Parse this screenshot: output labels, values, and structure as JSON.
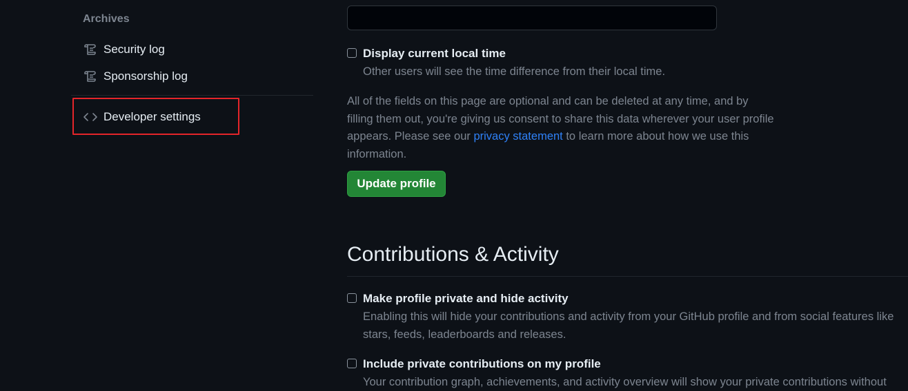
{
  "sidebar": {
    "heading": "Archives",
    "items": [
      {
        "label": "Security log",
        "icon": "log-icon"
      },
      {
        "label": "Sponsorship log",
        "icon": "log-icon"
      },
      {
        "label": "Developer settings",
        "icon": "code-icon"
      }
    ]
  },
  "main": {
    "top_input": {
      "value": ""
    },
    "local_time": {
      "label": "Display current local time",
      "description": "Other users will see the time difference from their local time."
    },
    "info": {
      "text_before_link": "All of the fields on this page are optional and can be deleted at any time, and by filling them out, you're giving us consent to share this data wherever your user profile appears. Please see our ",
      "link_text": "privacy statement",
      "text_after_link": " to learn more about how we use this information."
    },
    "update_button": "Update profile",
    "contributions": {
      "title": "Contributions & Activity",
      "private_profile": {
        "label": "Make profile private and hide activity",
        "description_line1": "Enabling this will hide your contributions and activity from your GitHub profile and from social features like",
        "description_line2": "stars, feeds, leaderboards and releases."
      },
      "private_contributions": {
        "label": "Include private contributions on my profile",
        "description": "Your contribution graph, achievements, and activity overview will show your private contributions without"
      }
    }
  },
  "colors": {
    "background": "#0d1117",
    "primary_button": "#238636",
    "link": "#2f81f7",
    "highlight": "#e5252a"
  }
}
